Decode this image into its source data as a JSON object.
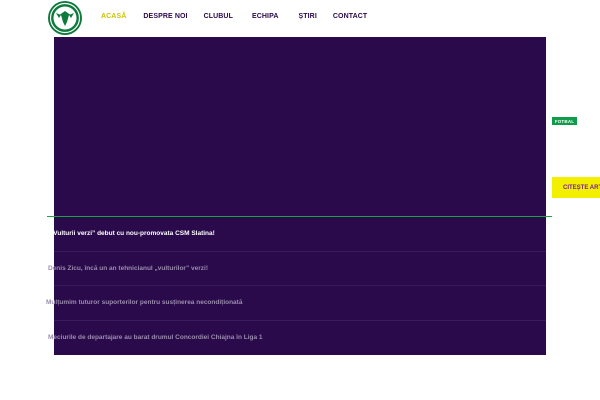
{
  "nav": {
    "items": [
      {
        "label": "ACASĂ",
        "active": true
      },
      {
        "label": "DESPRE NOI",
        "active": false
      },
      {
        "label": "CLUBUL",
        "active": false
      },
      {
        "label": "ECHIPA",
        "active": false
      },
      {
        "label": "ȘTIRI",
        "active": false
      },
      {
        "label": "CONTACT",
        "active": false
      }
    ]
  },
  "hero": {
    "category": "FOTBAL",
    "read_more": "CITEȘTE ART"
  },
  "news": [
    {
      "title": "„Vulturii verzi” debut cu nou-promovata CSM Slatina!",
      "current": true
    },
    {
      "title": "Denis Zicu, încă un an tehnicianul „vulturilor” verzi!",
      "current": false
    },
    {
      "title": "Mulțumim tuturor suporterilor pentru susținerea necondiționată",
      "current": false
    },
    {
      "title": "Meciurile de departajare au barat drumul Concordiei Chiajna în Liga 1",
      "current": false
    }
  ],
  "colors": {
    "brand_purple": "#2a0a4a",
    "accent_yellow": "#f2f000",
    "brand_green": "#0e9b4a"
  }
}
